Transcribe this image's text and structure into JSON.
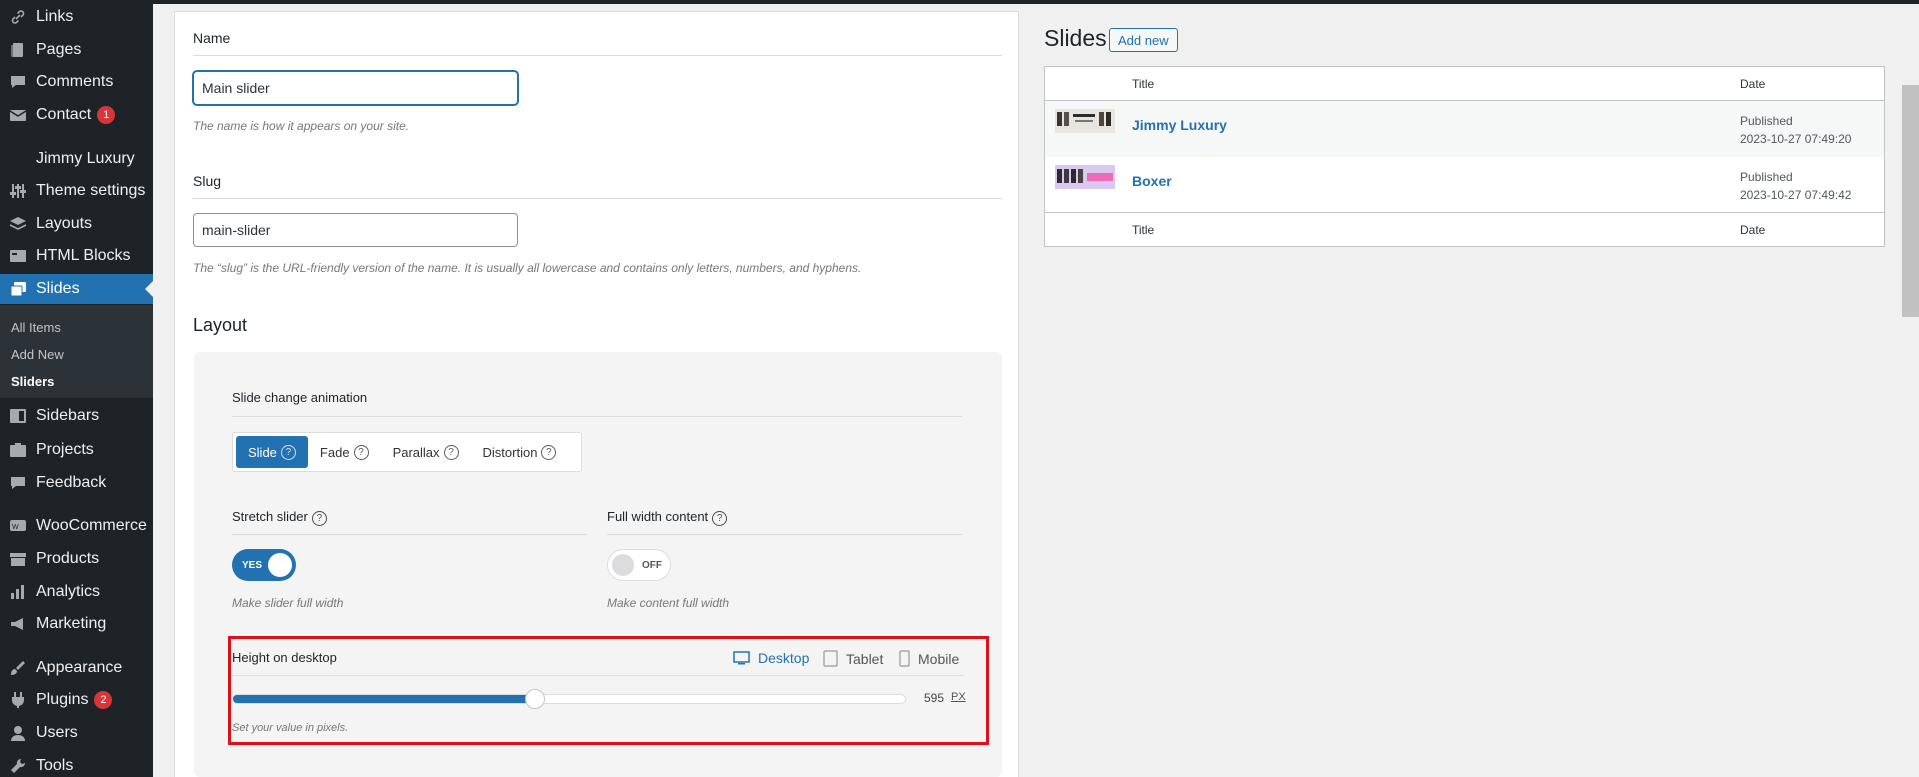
{
  "sidebar": {
    "items": [
      {
        "label": "Links",
        "icon": "link-icon"
      },
      {
        "label": "Pages",
        "icon": "page-icon"
      },
      {
        "label": "Comments",
        "icon": "comment-icon"
      },
      {
        "label": "Contact",
        "icon": "mail-icon",
        "badge": "1"
      },
      {
        "label": "Jimmy Luxury",
        "icon": ""
      },
      {
        "label": "Theme settings",
        "icon": "sliders-icon"
      },
      {
        "label": "Layouts",
        "icon": "layers-icon"
      },
      {
        "label": "HTML Blocks",
        "icon": "blocks-icon"
      },
      {
        "label": "Slides",
        "icon": "slides-icon"
      },
      {
        "label": "Sidebars",
        "icon": "sidebar-icon"
      },
      {
        "label": "Projects",
        "icon": "projects-icon"
      },
      {
        "label": "Feedback",
        "icon": "feedback-icon"
      },
      {
        "label": "WooCommerce",
        "icon": "woo-icon"
      },
      {
        "label": "Products",
        "icon": "archive-icon"
      },
      {
        "label": "Analytics",
        "icon": "chart-icon"
      },
      {
        "label": "Marketing",
        "icon": "megaphone-icon"
      },
      {
        "label": "Appearance",
        "icon": "brush-icon"
      },
      {
        "label": "Plugins",
        "icon": "plugin-icon",
        "badge": "2"
      },
      {
        "label": "Users",
        "icon": "user-icon"
      },
      {
        "label": "Tools",
        "icon": "wrench-icon"
      }
    ],
    "submenu": [
      "All Items",
      "Add New",
      "Sliders"
    ]
  },
  "form": {
    "name_label": "Name",
    "name_value": "Main slider",
    "name_hint": "The name is how it appears on your site.",
    "slug_label": "Slug",
    "slug_value": "main-slider",
    "slug_hint": "The “slug” is the URL-friendly version of the name. It is usually all lowercase and contains only letters, numbers, and hyphens.",
    "layout_title": "Layout",
    "animation_label": "Slide change animation",
    "animation_options": [
      "Slide",
      "Fade",
      "Parallax",
      "Distortion"
    ],
    "stretch_label": "Stretch slider",
    "stretch_toggle": "YES",
    "stretch_hint": "Make slider full width",
    "fullwidth_label": "Full width content",
    "fullwidth_toggle": "OFF",
    "fullwidth_hint": "Make content full width",
    "height_label": "Height on desktop",
    "devices": [
      "Desktop",
      "Tablet",
      "Mobile"
    ],
    "height_value": "595",
    "height_unit": "PX",
    "height_fill_fraction": 0.45,
    "height_hint": "Set your value in pixels."
  },
  "slides": {
    "title": "Slides",
    "add_new": "Add new",
    "col_title": "Title",
    "col_date": "Date",
    "rows": [
      {
        "title": "Jimmy Luxury",
        "status": "Published",
        "date": "2023-10-27 07:49:20"
      },
      {
        "title": "Boxer",
        "status": "Published",
        "date": "2023-10-27 07:49:42"
      }
    ]
  },
  "colors": {
    "accent": "#2271b1",
    "sidebar": "#1d2327",
    "highlight": "#e0101a",
    "badge": "#d63638"
  }
}
